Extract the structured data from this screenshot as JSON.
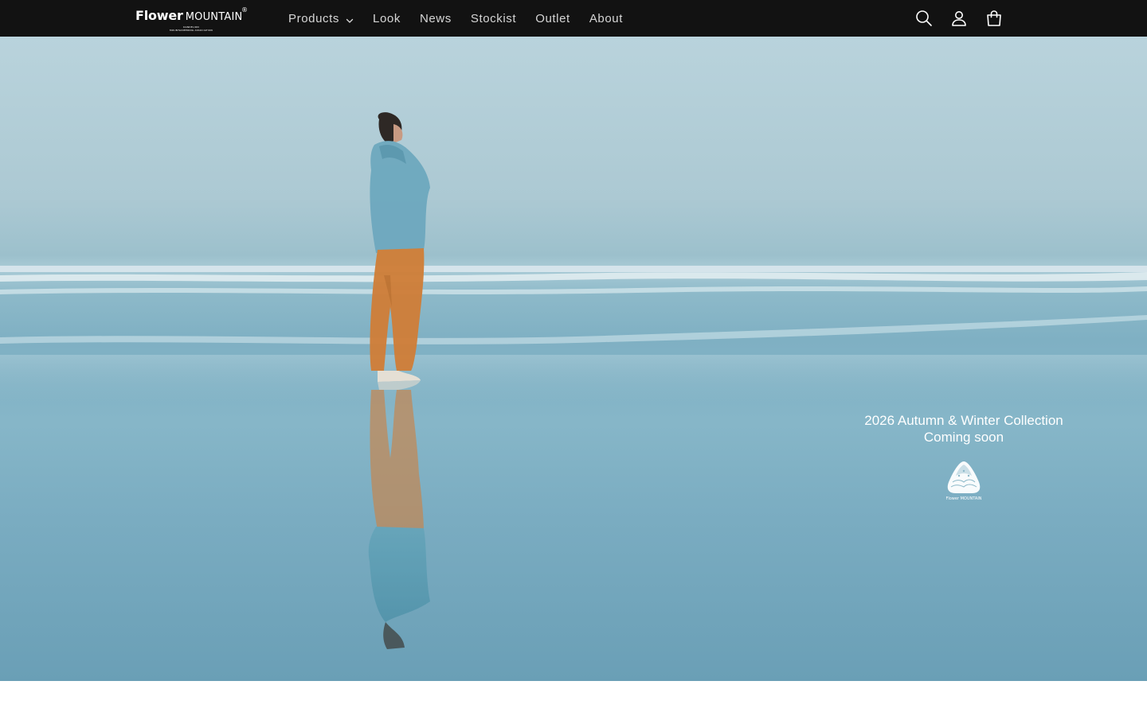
{
  "header": {
    "logo": {
      "word1": "Flower",
      "word2": "MOUNTAIN",
      "registered": "®",
      "sub_line1": "DANDELION",
      "sub_line2": "MOUNTAINEERING ASSOCIATION"
    },
    "nav": [
      {
        "label": "Products",
        "has_dropdown": true,
        "icon": "chevron-down-icon"
      },
      {
        "label": "Look"
      },
      {
        "label": "News"
      },
      {
        "label": "Stockist"
      },
      {
        "label": "Outlet"
      },
      {
        "label": "About"
      }
    ],
    "icons": [
      "search-icon",
      "account-icon",
      "cart-icon"
    ],
    "background_color": "#121212"
  },
  "hero": {
    "line1": "2026 Autumn & Winter Collection",
    "line2": "Coming soon",
    "emblem_caption": "Flower MOUNTAIN",
    "emblem_icon": "mountain-emblem-icon",
    "image_description_icon": "beach-photo"
  }
}
